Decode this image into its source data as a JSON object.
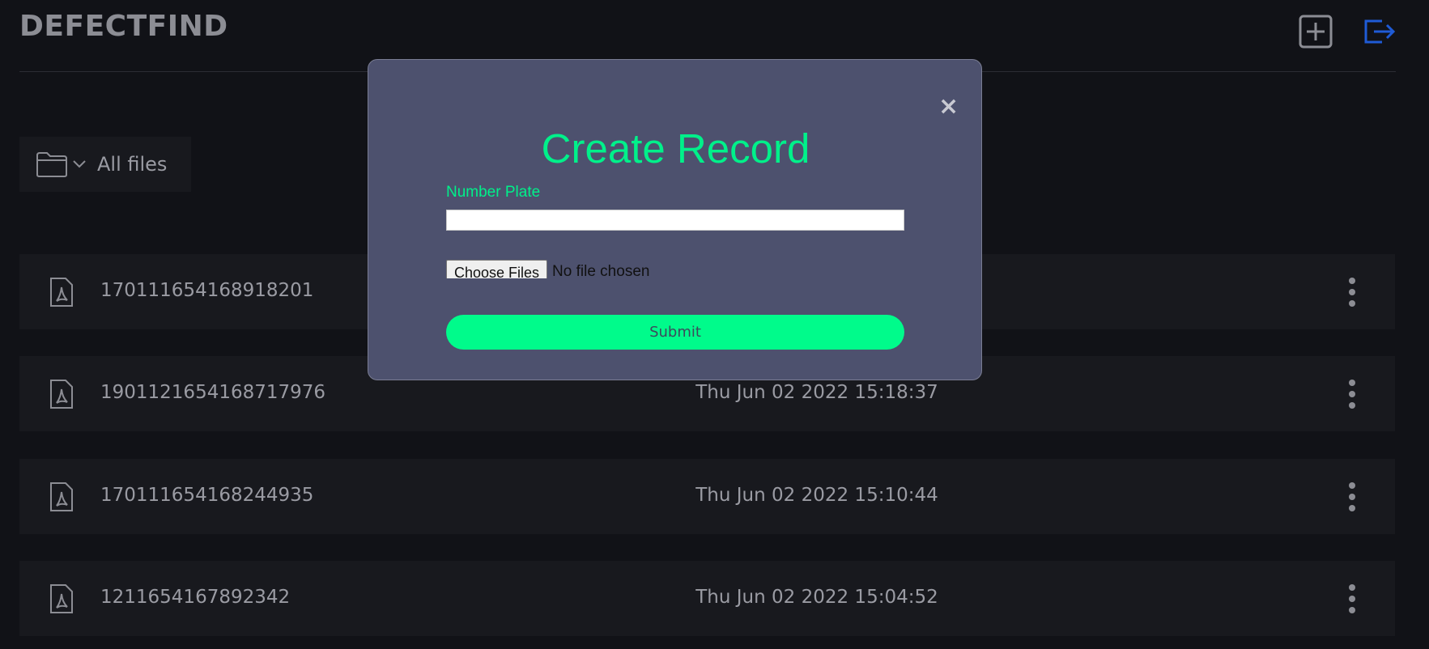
{
  "header": {
    "brand": "DEFECTFIND",
    "add_icon": "plus-square-icon",
    "logout_icon": "logout-icon",
    "colors": {
      "add": "#8c8d94",
      "logout": "#1f5bd6"
    }
  },
  "toolbar": {
    "folder_icon": "folder-icon",
    "chevron_icon": "chevron-down-icon",
    "label": "All files"
  },
  "files": [
    {
      "name": "170111654168918201",
      "date": ""
    },
    {
      "name": "1901121654168717976",
      "date": "Thu Jun 02 2022 15:18:37"
    },
    {
      "name": "170111654168244935",
      "date": "Thu Jun 02 2022 15:10:44"
    },
    {
      "name": "1211654167892342",
      "date": "Thu Jun 02 2022 15:04:52"
    }
  ],
  "modal": {
    "close": "×",
    "title": "Create Record",
    "plate_label": "Number Plate",
    "plate_value": "",
    "choose_files": "Choose Files",
    "no_file": "No file chosen",
    "submit": "Submit",
    "accent": "#00f08a"
  }
}
